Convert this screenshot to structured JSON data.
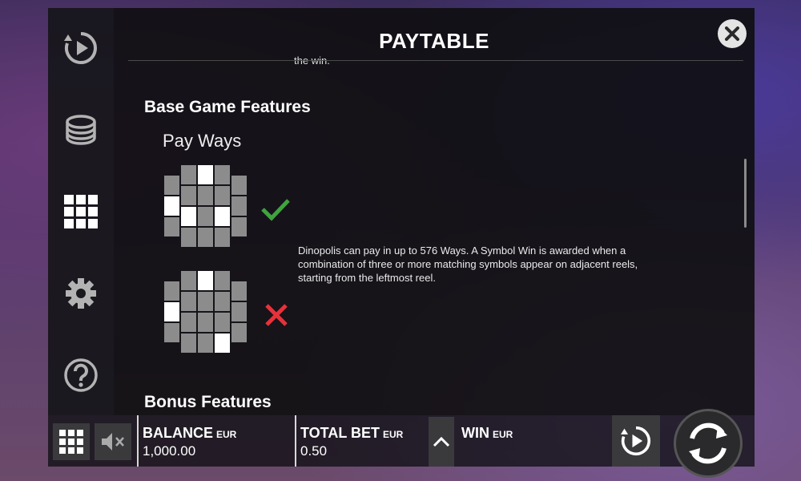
{
  "sidebar": {
    "items": [
      {
        "name": "autoplay-icon"
      },
      {
        "name": "coins-icon"
      },
      {
        "name": "paytable-grid-icon",
        "active": true
      },
      {
        "name": "settings-gear-icon"
      },
      {
        "name": "help-question-icon"
      }
    ]
  },
  "panel": {
    "title": "PAYTABLE",
    "close_icon": "close-icon",
    "cut_text": "the win.",
    "base_heading": "Base Game Features",
    "payways_heading": "Pay Ways",
    "payways_description": "Dinopolis can pay in up to 576 Ways. A Symbol Win is awarded when a combination of three or more matching symbols appear on adjacent reels, starting from the leftmost reel.",
    "bonus_heading": "Bonus Features",
    "examples": [
      {
        "result": "valid",
        "icon": "checkmark-icon",
        "highlighted": [
          [
            0,
            1
          ],
          [
            1,
            2
          ],
          [
            2,
            0
          ],
          [
            3,
            2
          ]
        ]
      },
      {
        "result": "invalid",
        "icon": "cross-icon",
        "highlighted": [
          [
            0,
            1
          ],
          [
            2,
            0
          ],
          [
            3,
            3
          ]
        ]
      }
    ]
  },
  "bottom": {
    "balance_label": "BALANCE",
    "balance_currency": "EUR",
    "balance_value": "1,000.00",
    "bet_label": "TOTAL BET",
    "bet_currency": "EUR",
    "bet_value": "0.50",
    "win_label": "WIN",
    "win_currency": "EUR"
  },
  "colors": {
    "check": "#3fa33f",
    "cross": "#e8313a",
    "cell_on": "#ffffff",
    "cell_off": "#8c8c8c"
  }
}
